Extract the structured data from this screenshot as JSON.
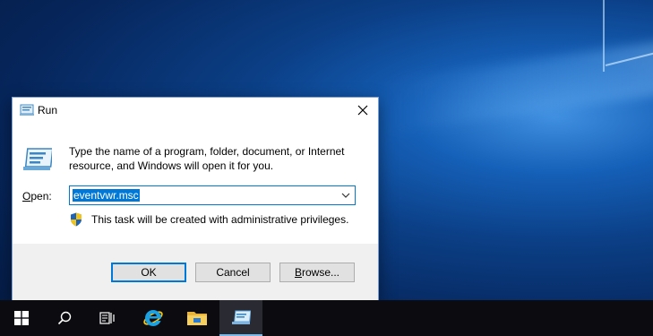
{
  "dialog": {
    "title": "Run",
    "description": "Type the name of a program, folder, document, or Internet resource, and Windows will open it for you.",
    "open_label_prefix": "",
    "open_label_accel": "O",
    "open_label_rest": "pen:",
    "open_value": "eventvwr.msc",
    "admin_note": "This task will be created with administrative privileges.",
    "buttons": {
      "ok": "OK",
      "cancel": "Cancel",
      "browse_accel": "B",
      "browse_rest": "rowse..."
    }
  },
  "taskbar": {
    "items": [
      "start-icon",
      "search-icon",
      "task-view-icon",
      "internet-explorer-icon",
      "file-explorer-icon",
      "run-icon"
    ]
  },
  "colors": {
    "accent": "#0078d7",
    "taskbar": "#0c0c10",
    "button_area": "#f0f0f0"
  }
}
